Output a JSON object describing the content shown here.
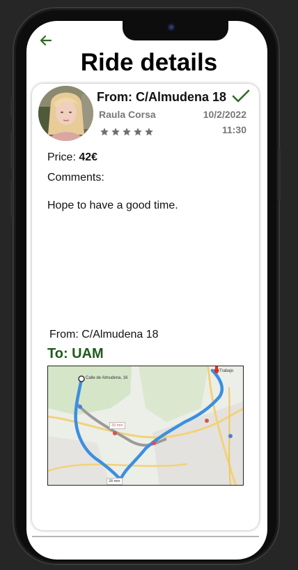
{
  "header": {
    "title": "Ride details",
    "back_icon": "arrow-left-icon",
    "accent_color": "#2e6b24"
  },
  "ride": {
    "from_header": "From: C/Almudena 18",
    "status_icon": "check-icon",
    "driver_name": "Raula Corsa",
    "date": "10/2/2022",
    "time": "11:30",
    "rating_stars": 5,
    "price_label": "Price:",
    "price_value": "42€",
    "comments_label": "Comments:",
    "comment": "Hope to have a good time."
  },
  "route": {
    "from": "From: C/Almudena 18",
    "to": "To: UAM",
    "to_color": "#1f5a1a",
    "map": {
      "origin_label": "Calle de Almudena, 16",
      "destination_label": "Trabajo",
      "car_time_label": "33 min",
      "alt_time_label": "28 min"
    }
  }
}
